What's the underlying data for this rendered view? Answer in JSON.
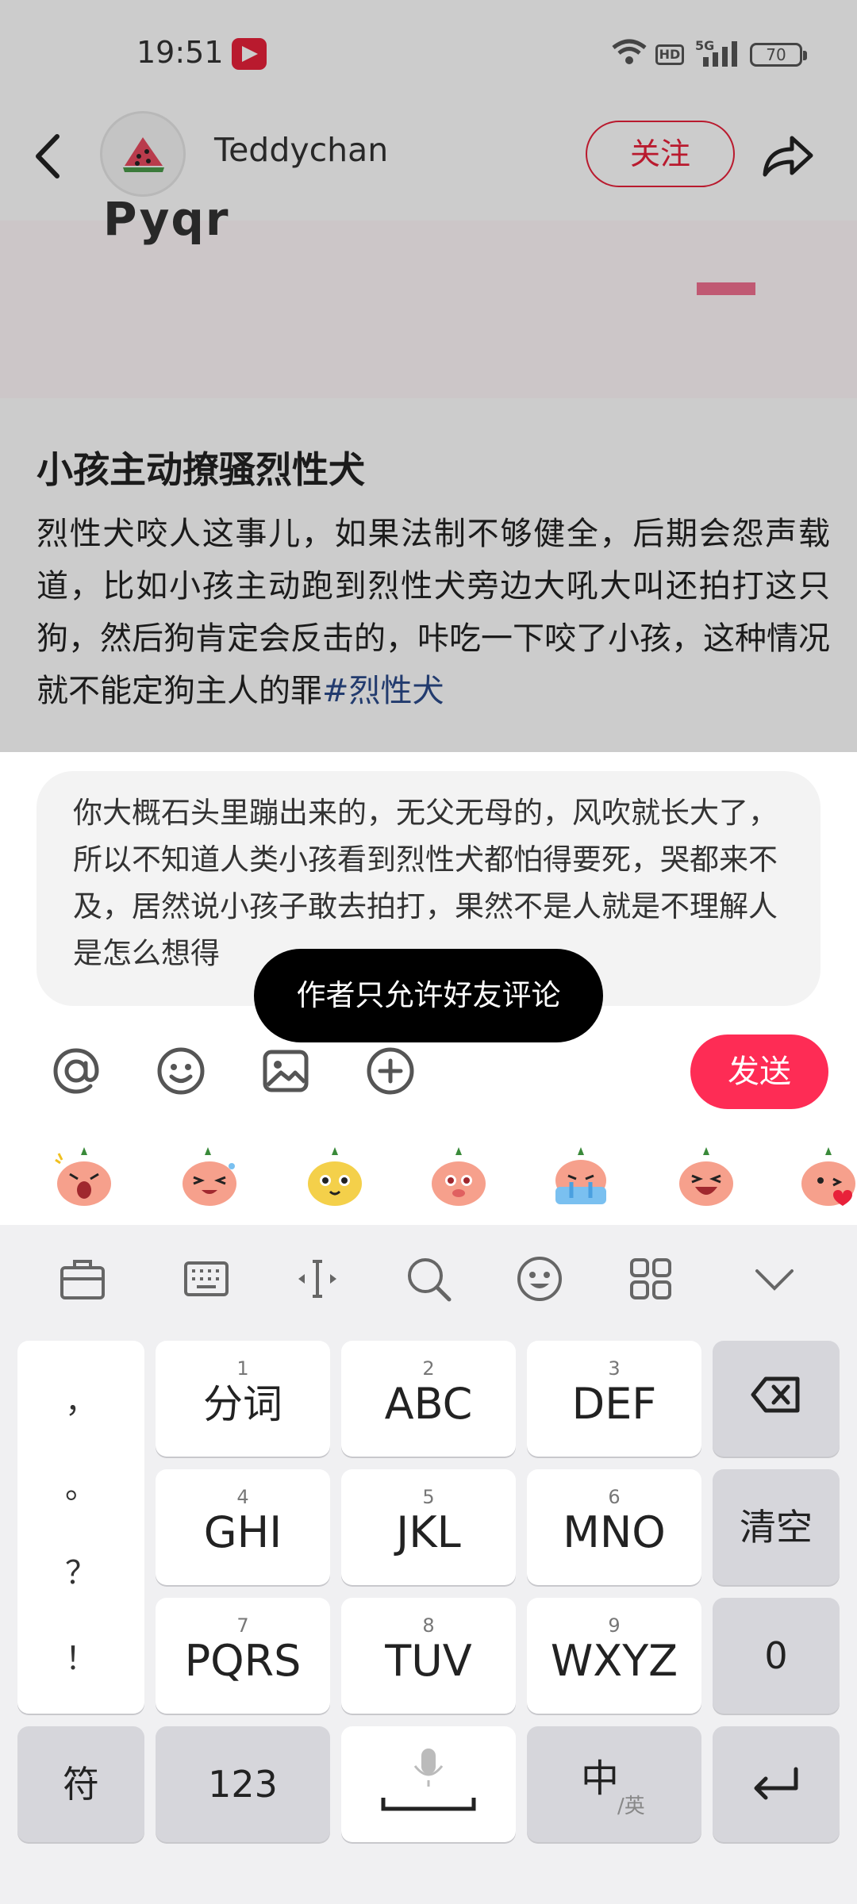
{
  "status": {
    "time": "19:51",
    "hd": "HD",
    "network": "5G",
    "battery": "70"
  },
  "header": {
    "author": "Teddychan",
    "follow_label": "关注"
  },
  "post": {
    "image_fragment": "Pyqr",
    "title": "小孩主动撩骚烈性犬",
    "text": "烈性犬咬人这事儿，如果法制不够健全，后期会怨声载道，比如小孩主动跑到烈性犬旁边大吼大叫还拍打这只狗，然后狗肯定会反击的，咔吃一下咬了小孩，这种情况就不能定狗主人的罪",
    "hashtag": "#烈性犬"
  },
  "comment": {
    "text": "你大概石头里蹦出来的，无父无母的，风吹就长大了，所以不知道人类小孩看到烈性犬都怕得要死，哭都来不及，居然说小孩子敢去拍打，果然不是人就是不理解人是怎么想得",
    "toast": "作者只允许好友评论",
    "send_label": "发送",
    "tool_icons": [
      "at-icon",
      "emoji-icon",
      "image-icon",
      "plus-icon"
    ],
    "stickers": [
      "sticker-shout",
      "sticker-laugh-cry",
      "sticker-yellow-smile",
      "sticker-shy",
      "sticker-crying",
      "sticker-big-laugh",
      "sticker-heart"
    ]
  },
  "keyboard": {
    "toolbar_icons": [
      "clipboard-icon",
      "keyboard-icon",
      "cursor-icon",
      "search-icon",
      "emoji-icon",
      "apps-icon",
      "chevron-down-icon"
    ],
    "punctuation": [
      "，",
      "。",
      "？",
      "！"
    ],
    "keys": {
      "k1": {
        "num": "1",
        "label": "分词"
      },
      "k2": {
        "num": "2",
        "label": "ABC"
      },
      "k3": {
        "num": "3",
        "label": "DEF"
      },
      "k4": {
        "num": "4",
        "label": "GHI"
      },
      "k5": {
        "num": "5",
        "label": "JKL"
      },
      "k6": {
        "num": "6",
        "label": "MNO"
      },
      "k7": {
        "num": "7",
        "label": "PQRS"
      },
      "k8": {
        "num": "8",
        "label": "TUV"
      },
      "k9": {
        "num": "9",
        "label": "WXYZ"
      }
    },
    "clear_label": "清空",
    "zero_label": "0",
    "symbol_label": "符",
    "num_label": "123",
    "lang_cn": "中",
    "lang_en": "英"
  }
}
